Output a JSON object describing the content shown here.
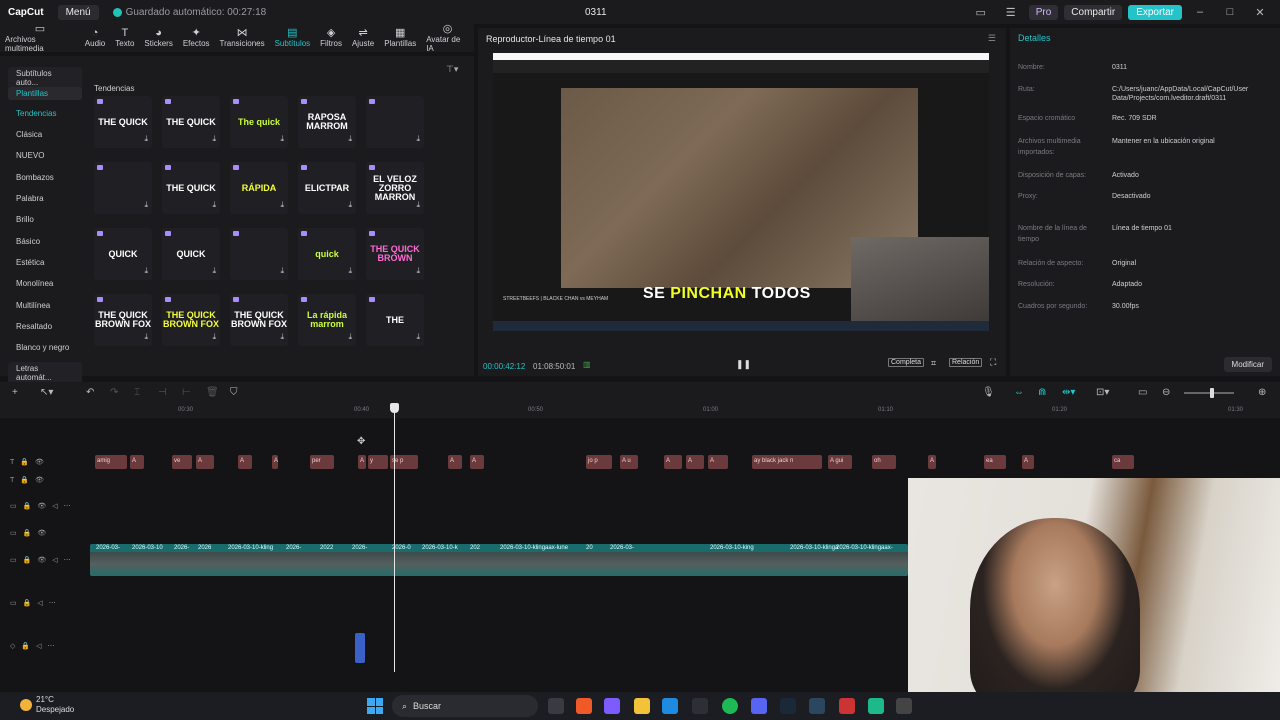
{
  "titlebar": {
    "logo": "CapCut",
    "menu": "Menú",
    "autosave": "Guardado automático: 00:27:18",
    "doc_title": "0311",
    "pro": "Pro",
    "share": "Compartir",
    "export": "Exportar"
  },
  "toolbar": [
    {
      "label": "Archivos multimedia",
      "icon": "▭"
    },
    {
      "label": "Audio",
      "icon": "◔"
    },
    {
      "label": "Texto",
      "icon": "T"
    },
    {
      "label": "Stickers",
      "icon": "◕"
    },
    {
      "label": "Efectos",
      "icon": "✦"
    },
    {
      "label": "Transiciones",
      "icon": "⋈"
    },
    {
      "label": "Subtítulos",
      "icon": "▤",
      "active": true
    },
    {
      "label": "Filtros",
      "icon": "◈"
    },
    {
      "label": "Ajuste",
      "icon": "⇌"
    },
    {
      "label": "Plantillas",
      "icon": "▦"
    },
    {
      "label": "Avatar de IA",
      "icon": "◎"
    }
  ],
  "sidebar": {
    "items": [
      {
        "label": "Subtítulos auto..."
      },
      {
        "label": "Plantillas",
        "active": true
      },
      {
        "label": "Tendencias",
        "active": true
      },
      {
        "label": "Clásica"
      },
      {
        "label": "NUEVO"
      },
      {
        "label": "Bombazos"
      },
      {
        "label": "Palabra"
      },
      {
        "label": "Brillo"
      },
      {
        "label": "Básico"
      },
      {
        "label": "Estética"
      },
      {
        "label": "Monolínea"
      },
      {
        "label": "Multilínea"
      },
      {
        "label": "Resaltado"
      },
      {
        "label": "Blanco y negro"
      },
      {
        "label": "Letras automát..."
      }
    ]
  },
  "templates": {
    "section_title": "Tendencias",
    "items": [
      {
        "text": "THE QUICK",
        "color": "#ffffff"
      },
      {
        "text": "THE QUICK",
        "color": "#ffffff"
      },
      {
        "text": "The quick",
        "color": "#c9ff3b"
      },
      {
        "text": "RAPOSA MARROM",
        "color": "#ffffff"
      },
      {
        "text": "",
        "color": "#9d7cff"
      },
      {
        "text": "",
        "color": "#ff7ab8"
      },
      {
        "text": "THE QUICK",
        "color": "#ffffff"
      },
      {
        "text": "RÁPIDA",
        "color": "#f4ff3b"
      },
      {
        "text": "ELICTPAR",
        "color": "#ffffff"
      },
      {
        "text": "EL VELOZ ZORRO MARRON",
        "color": "#ffffff"
      },
      {
        "text": "QUICK",
        "color": "#ffffff"
      },
      {
        "text": "QUICK",
        "color": "#ffffff"
      },
      {
        "text": "",
        "color": "#f4e24a"
      },
      {
        "text": "quick",
        "color": "#c9ff3b"
      },
      {
        "text": "THE QUICK BROWN",
        "color": "#ff6ad5"
      },
      {
        "text": "THE QUICK BROWN FOX",
        "color": "#ffffff"
      },
      {
        "text": "THE QUICK BROWN FOX",
        "color": "#f4ff3b"
      },
      {
        "text": "THE QUICK BROWN FOX",
        "color": "#ffffff"
      },
      {
        "text": "La rápida marrom",
        "color": "#c9ff3b"
      },
      {
        "text": "THE",
        "color": "#ffffff"
      }
    ]
  },
  "player": {
    "title": "Reproductor-Línea de tiempo 01",
    "subtitle_white": "SE ",
    "subtitle_highlight": "PINCHAN",
    "subtitle_end": " TODOS",
    "channel": "STREETBEEFS | BLACKE CHAN vs MEYHAM",
    "current_time": "00:00:42:12",
    "total_time": "01:08:50:01",
    "btn_complete": "Completa",
    "btn_ratio": "Relación"
  },
  "details": {
    "header": "Detalles",
    "rows": [
      {
        "label": "Nombre:",
        "value": "0311"
      },
      {
        "label": "Ruta:",
        "value": "C:/Users/juanc/AppData/Local/CapCut/User Data/Projects/com.lveditor.draft/0311"
      },
      {
        "label": "Espacio cromático",
        "value": "Rec. 709 SDR"
      },
      {
        "label": "Archivos multimedia importados:",
        "value": "Mantener en la ubicación original"
      },
      {
        "label": "Disposición de capas:",
        "value": "Activado"
      },
      {
        "label": "Proxy:",
        "value": "Desactivado"
      },
      {
        "label": "Nombre de la línea de tiempo",
        "value": "Línea de tiempo 01"
      },
      {
        "label": "Relación de aspecto:",
        "value": "Original"
      },
      {
        "label": "Resolución:",
        "value": "Adaptado"
      },
      {
        "label": "Cuadros por segundo:",
        "value": "30.00fps"
      }
    ],
    "modify": "Modificar"
  },
  "ruler": {
    "ticks": [
      "00:30",
      "00:40",
      "00:50",
      "01:00",
      "01:10",
      "01:20",
      "01:30"
    ]
  },
  "timeline": {
    "subtitle_clips": [
      "amig",
      "A",
      "ve",
      "A",
      "A",
      "A",
      "per",
      "A",
      "y",
      "se p",
      "A",
      "A",
      "jo p",
      "A u",
      "A",
      "A",
      "A",
      "ay black jack n",
      "A gui",
      "oh",
      "A",
      "ea",
      "A",
      "ca"
    ],
    "video_labels": [
      "2026-03-",
      "2026-03-10",
      "2026-",
      "2026",
      "2026-03-10-kling",
      "2026-",
      "2022",
      "2026-",
      "2026-0",
      "2026-03-10-k",
      "202",
      "2026-03-10-klingaax-lune",
      "20",
      "2026-03-",
      "2026-03-10-king",
      "2026-03-10-klinga",
      "2026-03-10-klingaax-"
    ]
  },
  "taskbar": {
    "temp": "21°C",
    "weather": "Despejado",
    "search": "Buscar"
  }
}
